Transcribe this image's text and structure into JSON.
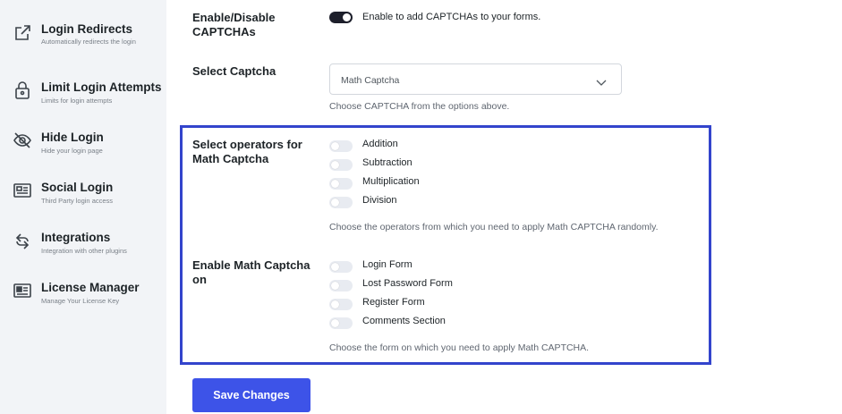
{
  "sidebar": {
    "items": [
      {
        "title": "Login Redirects",
        "subtitle": "Automatically redirects the login",
        "icon": "external-link-icon"
      },
      {
        "title": "Limit Login Attempts",
        "subtitle": "Limits for login attempts",
        "icon": "lock-icon"
      },
      {
        "title": "Hide Login",
        "subtitle": "Hide your login page",
        "icon": "eye-off-icon"
      },
      {
        "title": "Social Login",
        "subtitle": "Third Party login access",
        "icon": "id-card-icon"
      },
      {
        "title": "Integrations",
        "subtitle": "Integration with other plugins",
        "icon": "integrations-icon"
      },
      {
        "title": "License Manager",
        "subtitle": "Manage Your License Key",
        "icon": "license-card-icon"
      }
    ]
  },
  "captcha_toggle": {
    "label": "Enable/Disable CAPTCHAs",
    "description": "Enable to add CAPTCHAs to your forms.",
    "enabled": true
  },
  "captcha_select": {
    "label": "Select Captcha",
    "value": "Math Captcha",
    "help": "Choose CAPTCHA from the options above."
  },
  "operators": {
    "label": "Select operators for Math Captcha",
    "options": [
      {
        "label": "Addition",
        "enabled": false
      },
      {
        "label": "Subtraction",
        "enabled": false
      },
      {
        "label": "Multiplication",
        "enabled": false
      },
      {
        "label": "Division",
        "enabled": false
      }
    ],
    "help": "Choose the operators from which you need to apply Math CAPTCHA randomly."
  },
  "forms": {
    "label": "Enable Math Captcha on",
    "options": [
      {
        "label": "Login Form",
        "enabled": false
      },
      {
        "label": "Lost Password Form",
        "enabled": false
      },
      {
        "label": "Register Form",
        "enabled": false
      },
      {
        "label": "Comments Section",
        "enabled": false
      }
    ],
    "help": "Choose the form on which you need to apply Math CAPTCHA."
  },
  "save_button": {
    "label": "Save Changes"
  },
  "colors": {
    "accent": "#3d53e8",
    "highlight_border": "#3344cc",
    "toggle_on": "#1d1f2b",
    "toggle_off": "#e8ebf1",
    "sidebar_bg": "#f2f4f7"
  }
}
